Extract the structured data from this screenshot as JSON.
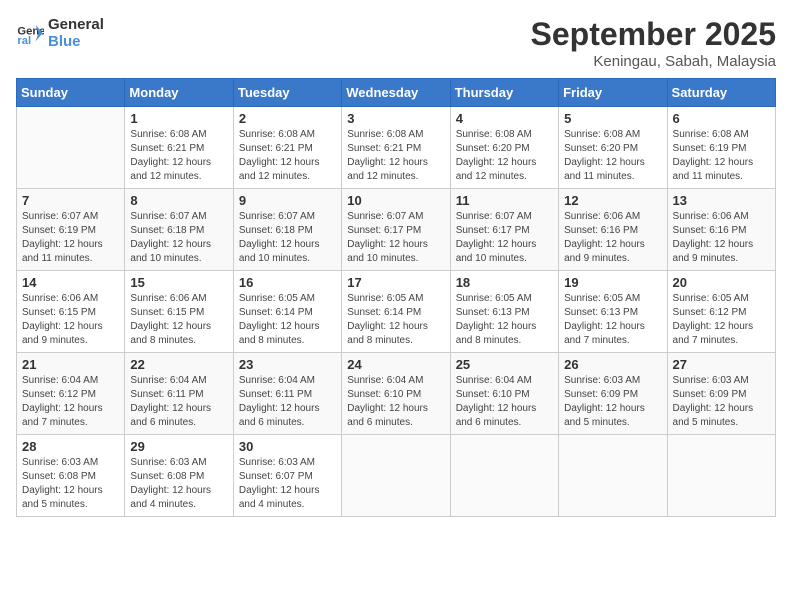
{
  "logo": {
    "line1": "General",
    "line2": "Blue"
  },
  "title": "September 2025",
  "location": "Keningau, Sabah, Malaysia",
  "days_of_week": [
    "Sunday",
    "Monday",
    "Tuesday",
    "Wednesday",
    "Thursday",
    "Friday",
    "Saturday"
  ],
  "weeks": [
    [
      {
        "day": "",
        "info": ""
      },
      {
        "day": "1",
        "info": "Sunrise: 6:08 AM\nSunset: 6:21 PM\nDaylight: 12 hours\nand 12 minutes."
      },
      {
        "day": "2",
        "info": "Sunrise: 6:08 AM\nSunset: 6:21 PM\nDaylight: 12 hours\nand 12 minutes."
      },
      {
        "day": "3",
        "info": "Sunrise: 6:08 AM\nSunset: 6:21 PM\nDaylight: 12 hours\nand 12 minutes."
      },
      {
        "day": "4",
        "info": "Sunrise: 6:08 AM\nSunset: 6:20 PM\nDaylight: 12 hours\nand 12 minutes."
      },
      {
        "day": "5",
        "info": "Sunrise: 6:08 AM\nSunset: 6:20 PM\nDaylight: 12 hours\nand 11 minutes."
      },
      {
        "day": "6",
        "info": "Sunrise: 6:08 AM\nSunset: 6:19 PM\nDaylight: 12 hours\nand 11 minutes."
      }
    ],
    [
      {
        "day": "7",
        "info": "Sunrise: 6:07 AM\nSunset: 6:19 PM\nDaylight: 12 hours\nand 11 minutes."
      },
      {
        "day": "8",
        "info": "Sunrise: 6:07 AM\nSunset: 6:18 PM\nDaylight: 12 hours\nand 10 minutes."
      },
      {
        "day": "9",
        "info": "Sunrise: 6:07 AM\nSunset: 6:18 PM\nDaylight: 12 hours\nand 10 minutes."
      },
      {
        "day": "10",
        "info": "Sunrise: 6:07 AM\nSunset: 6:17 PM\nDaylight: 12 hours\nand 10 minutes."
      },
      {
        "day": "11",
        "info": "Sunrise: 6:07 AM\nSunset: 6:17 PM\nDaylight: 12 hours\nand 10 minutes."
      },
      {
        "day": "12",
        "info": "Sunrise: 6:06 AM\nSunset: 6:16 PM\nDaylight: 12 hours\nand 9 minutes."
      },
      {
        "day": "13",
        "info": "Sunrise: 6:06 AM\nSunset: 6:16 PM\nDaylight: 12 hours\nand 9 minutes."
      }
    ],
    [
      {
        "day": "14",
        "info": "Sunrise: 6:06 AM\nSunset: 6:15 PM\nDaylight: 12 hours\nand 9 minutes."
      },
      {
        "day": "15",
        "info": "Sunrise: 6:06 AM\nSunset: 6:15 PM\nDaylight: 12 hours\nand 8 minutes."
      },
      {
        "day": "16",
        "info": "Sunrise: 6:05 AM\nSunset: 6:14 PM\nDaylight: 12 hours\nand 8 minutes."
      },
      {
        "day": "17",
        "info": "Sunrise: 6:05 AM\nSunset: 6:14 PM\nDaylight: 12 hours\nand 8 minutes."
      },
      {
        "day": "18",
        "info": "Sunrise: 6:05 AM\nSunset: 6:13 PM\nDaylight: 12 hours\nand 8 minutes."
      },
      {
        "day": "19",
        "info": "Sunrise: 6:05 AM\nSunset: 6:13 PM\nDaylight: 12 hours\nand 7 minutes."
      },
      {
        "day": "20",
        "info": "Sunrise: 6:05 AM\nSunset: 6:12 PM\nDaylight: 12 hours\nand 7 minutes."
      }
    ],
    [
      {
        "day": "21",
        "info": "Sunrise: 6:04 AM\nSunset: 6:12 PM\nDaylight: 12 hours\nand 7 minutes."
      },
      {
        "day": "22",
        "info": "Sunrise: 6:04 AM\nSunset: 6:11 PM\nDaylight: 12 hours\nand 6 minutes."
      },
      {
        "day": "23",
        "info": "Sunrise: 6:04 AM\nSunset: 6:11 PM\nDaylight: 12 hours\nand 6 minutes."
      },
      {
        "day": "24",
        "info": "Sunrise: 6:04 AM\nSunset: 6:10 PM\nDaylight: 12 hours\nand 6 minutes."
      },
      {
        "day": "25",
        "info": "Sunrise: 6:04 AM\nSunset: 6:10 PM\nDaylight: 12 hours\nand 6 minutes."
      },
      {
        "day": "26",
        "info": "Sunrise: 6:03 AM\nSunset: 6:09 PM\nDaylight: 12 hours\nand 5 minutes."
      },
      {
        "day": "27",
        "info": "Sunrise: 6:03 AM\nSunset: 6:09 PM\nDaylight: 12 hours\nand 5 minutes."
      }
    ],
    [
      {
        "day": "28",
        "info": "Sunrise: 6:03 AM\nSunset: 6:08 PM\nDaylight: 12 hours\nand 5 minutes."
      },
      {
        "day": "29",
        "info": "Sunrise: 6:03 AM\nSunset: 6:08 PM\nDaylight: 12 hours\nand 4 minutes."
      },
      {
        "day": "30",
        "info": "Sunrise: 6:03 AM\nSunset: 6:07 PM\nDaylight: 12 hours\nand 4 minutes."
      },
      {
        "day": "",
        "info": ""
      },
      {
        "day": "",
        "info": ""
      },
      {
        "day": "",
        "info": ""
      },
      {
        "day": "",
        "info": ""
      }
    ]
  ]
}
